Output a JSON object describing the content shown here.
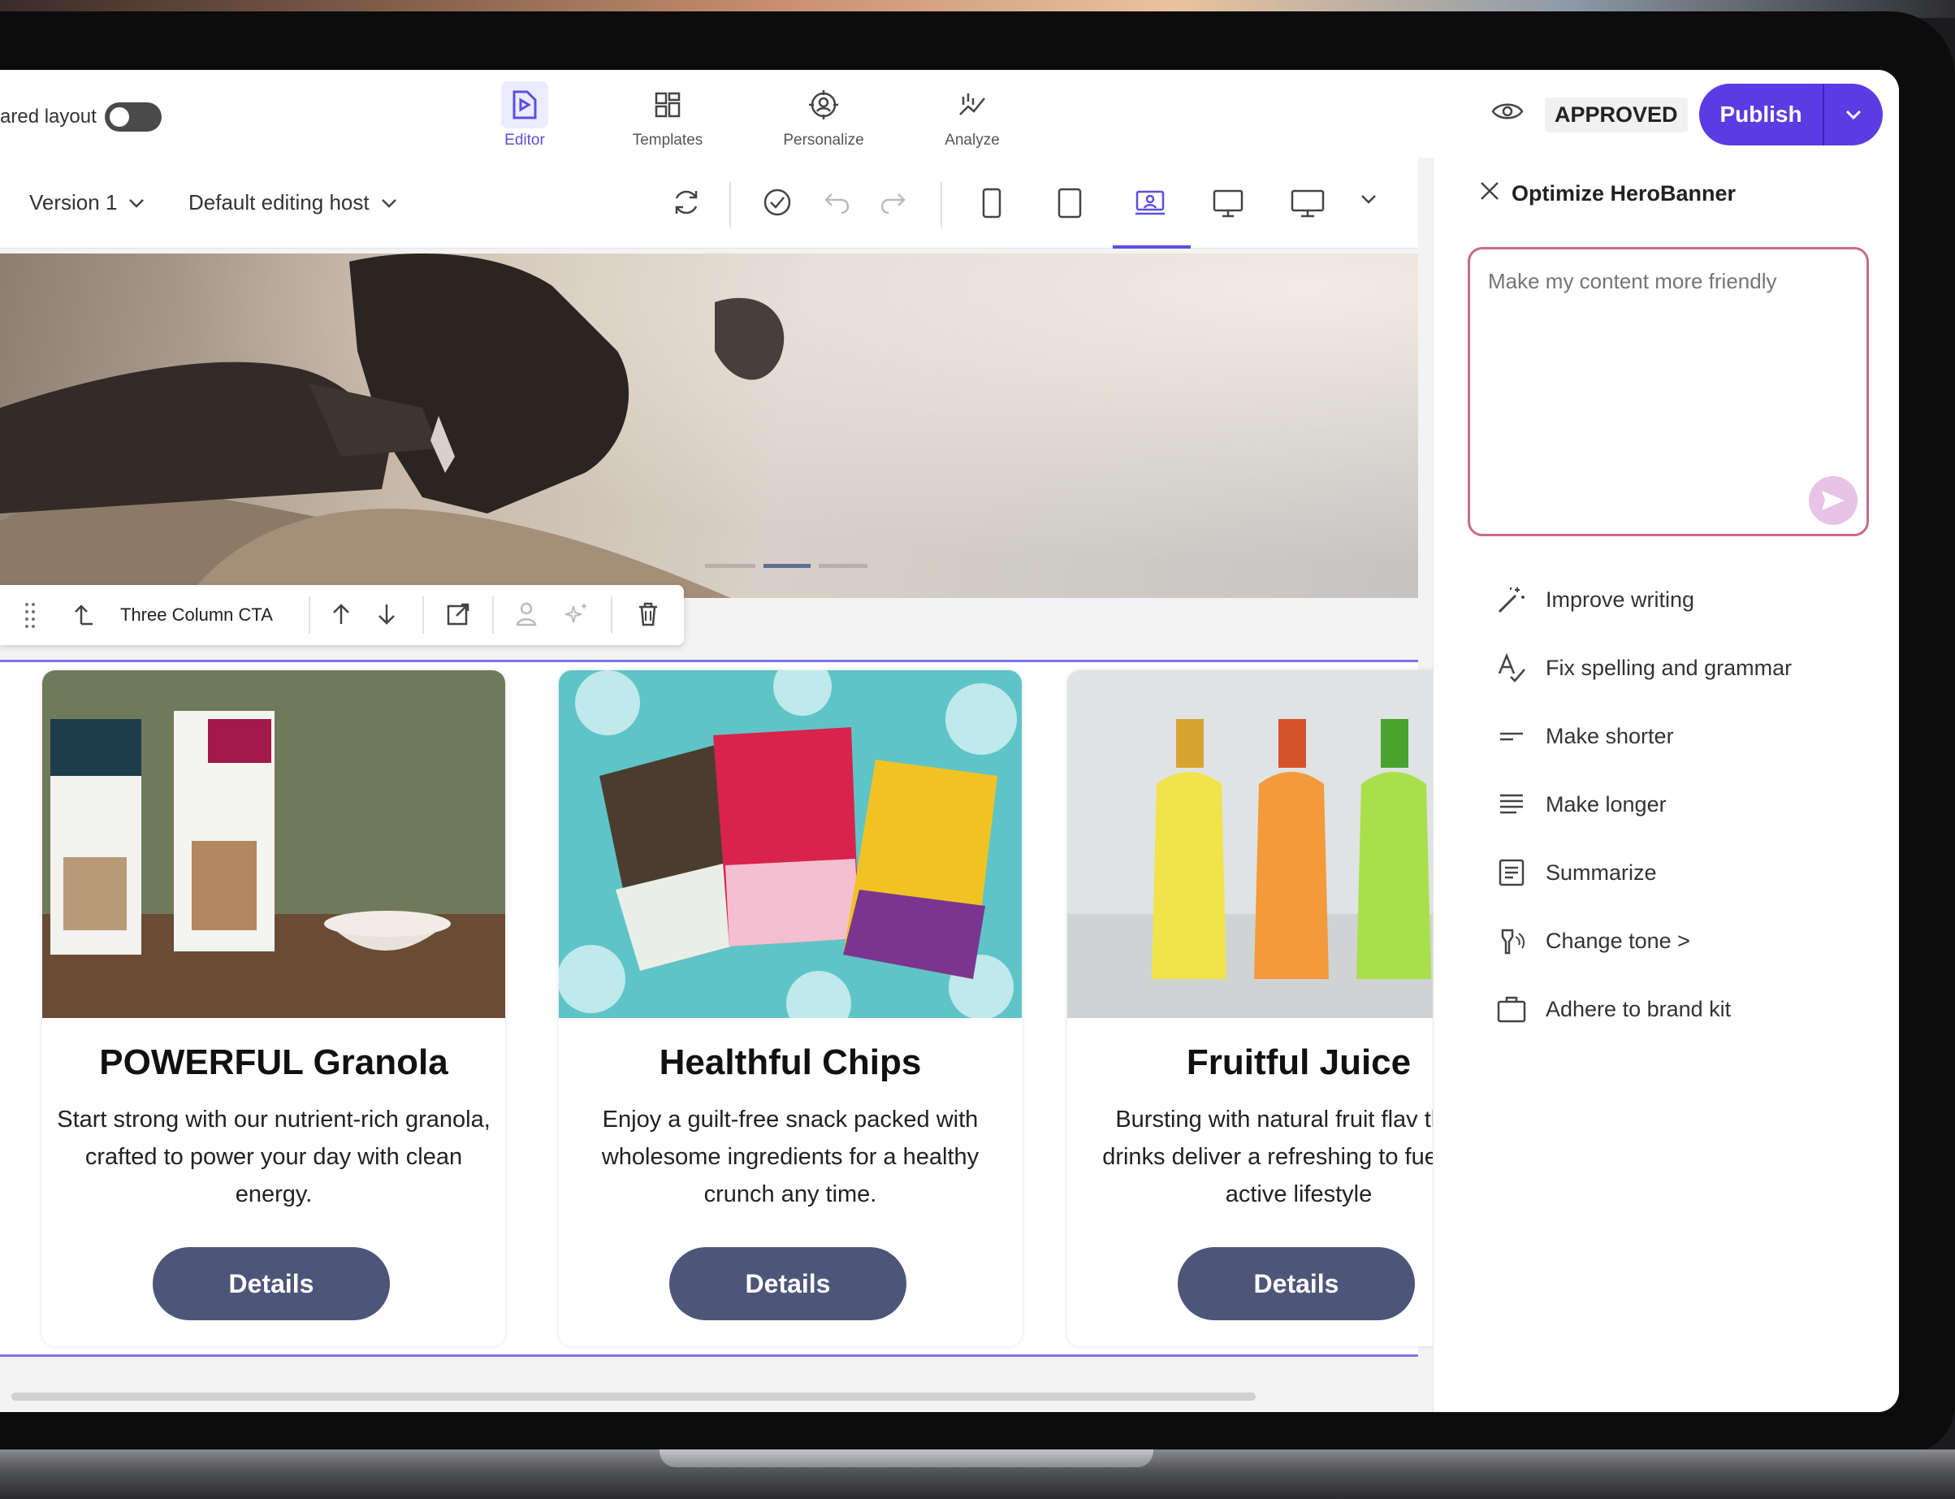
{
  "topbar": {
    "shared_layout_label": "ared layout",
    "tabs": [
      {
        "label": "Editor",
        "icon": "editor-icon",
        "active": true
      },
      {
        "label": "Templates",
        "icon": "templates-icon",
        "active": false
      },
      {
        "label": "Personalize",
        "icon": "personalize-icon",
        "active": false
      },
      {
        "label": "Analyze",
        "icon": "analyze-icon",
        "active": false
      }
    ],
    "status": "APPROVED",
    "publish_label": "Publish"
  },
  "toolbar": {
    "version": "Version 1",
    "host": "Default editing host"
  },
  "component_bar": {
    "name": "Three Column CTA"
  },
  "cards": [
    {
      "title": "POWERFUL Granola",
      "description": "Start strong with our nutrient-rich granola, crafted to power your day with clean energy.",
      "button": "Details"
    },
    {
      "title": "Healthful Chips",
      "description": "Enjoy a guilt-free snack packed with wholesome ingredients for a healthy crunch any time.",
      "button": "Details"
    },
    {
      "title": "Fruitful Juice",
      "description": "Bursting with natural fruit flav these drinks deliver a refreshing to fuel your active lifestyle",
      "button": "Details"
    }
  ],
  "panel": {
    "title": "Optimize HeroBanner",
    "prompt_placeholder": "Make my content more friendly",
    "actions": [
      {
        "label": "Improve writing",
        "icon": "magic-wand-icon"
      },
      {
        "label": "Fix spelling and grammar",
        "icon": "spellcheck-icon"
      },
      {
        "label": "Make shorter",
        "icon": "shorten-icon"
      },
      {
        "label": "Make longer",
        "icon": "lengthen-icon"
      },
      {
        "label": "Summarize",
        "icon": "summarize-icon"
      },
      {
        "label": "Change tone >",
        "icon": "tone-icon"
      },
      {
        "label": "Adhere to brand kit",
        "icon": "briefcase-icon"
      }
    ]
  },
  "colors": {
    "accent": "#5b3be3",
    "selection": "#7c73e6",
    "button": "#4d5679",
    "prompt_border": "#c9698a"
  }
}
